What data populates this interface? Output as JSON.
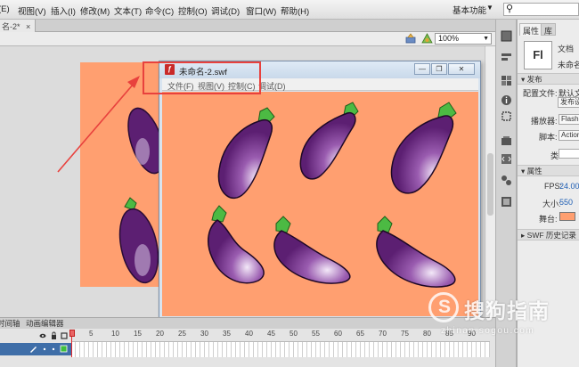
{
  "menubar": {
    "items": [
      "(E)",
      "视图(V)",
      "插入(I)",
      "修改(M)",
      "文本(T)",
      "命令(C)",
      "控制(O)",
      "调试(D)",
      "窗口(W)",
      "帮助(H)"
    ],
    "workspace": "基本功能",
    "workspace_caret": "▼"
  },
  "document": {
    "tab_label": "名-2*",
    "close_glyph": "×",
    "zoom": "100%"
  },
  "swf_window": {
    "title": "未命名-2.swf",
    "app_icon": "ƒ",
    "menu": [
      "文件(F)",
      "视图(V)",
      "控制(C)",
      "调试(D)"
    ],
    "buttons": {
      "minimize": "—",
      "restore": "❐",
      "close": "✕"
    }
  },
  "properties": {
    "tabs": [
      "属性",
      "库"
    ],
    "icon_label": "Fl",
    "doc_kind": "文档",
    "doc_name": "未命名",
    "publish_section": "发布",
    "profile_label": "配置文件:",
    "profile_value": "默认文",
    "publish_settings": "发布设",
    "player_label": "播放器:",
    "player_value": "Flash",
    "script_label": "脚本:",
    "script_value": "Action",
    "class_label": "类:",
    "attributes_section": "属性",
    "fps_label": "FPS:",
    "fps_value": "24.00",
    "size_label": "大小:",
    "size_value": "550",
    "stage_label": "舞台:",
    "stage_color": "#ff9f70",
    "history_section": "SWF 历史记录"
  },
  "timeline": {
    "tabs": [
      "时间轴",
      "动画编辑器"
    ],
    "frame_numbers": [
      "1",
      "5",
      "10",
      "15",
      "20",
      "25",
      "30",
      "35",
      "40",
      "45",
      "50",
      "55",
      "60",
      "65",
      "70",
      "75",
      "80",
      "85",
      "90"
    ]
  },
  "watermark": {
    "title": "搜狗指南",
    "url": "zhinan.sogou.com",
    "logo_char": "S"
  },
  "colors": {
    "stage": "#ff9f70",
    "eggplant_body": "#5c1f72",
    "eggplant_cap": "#4cba43",
    "annotation": "#e8413d"
  }
}
